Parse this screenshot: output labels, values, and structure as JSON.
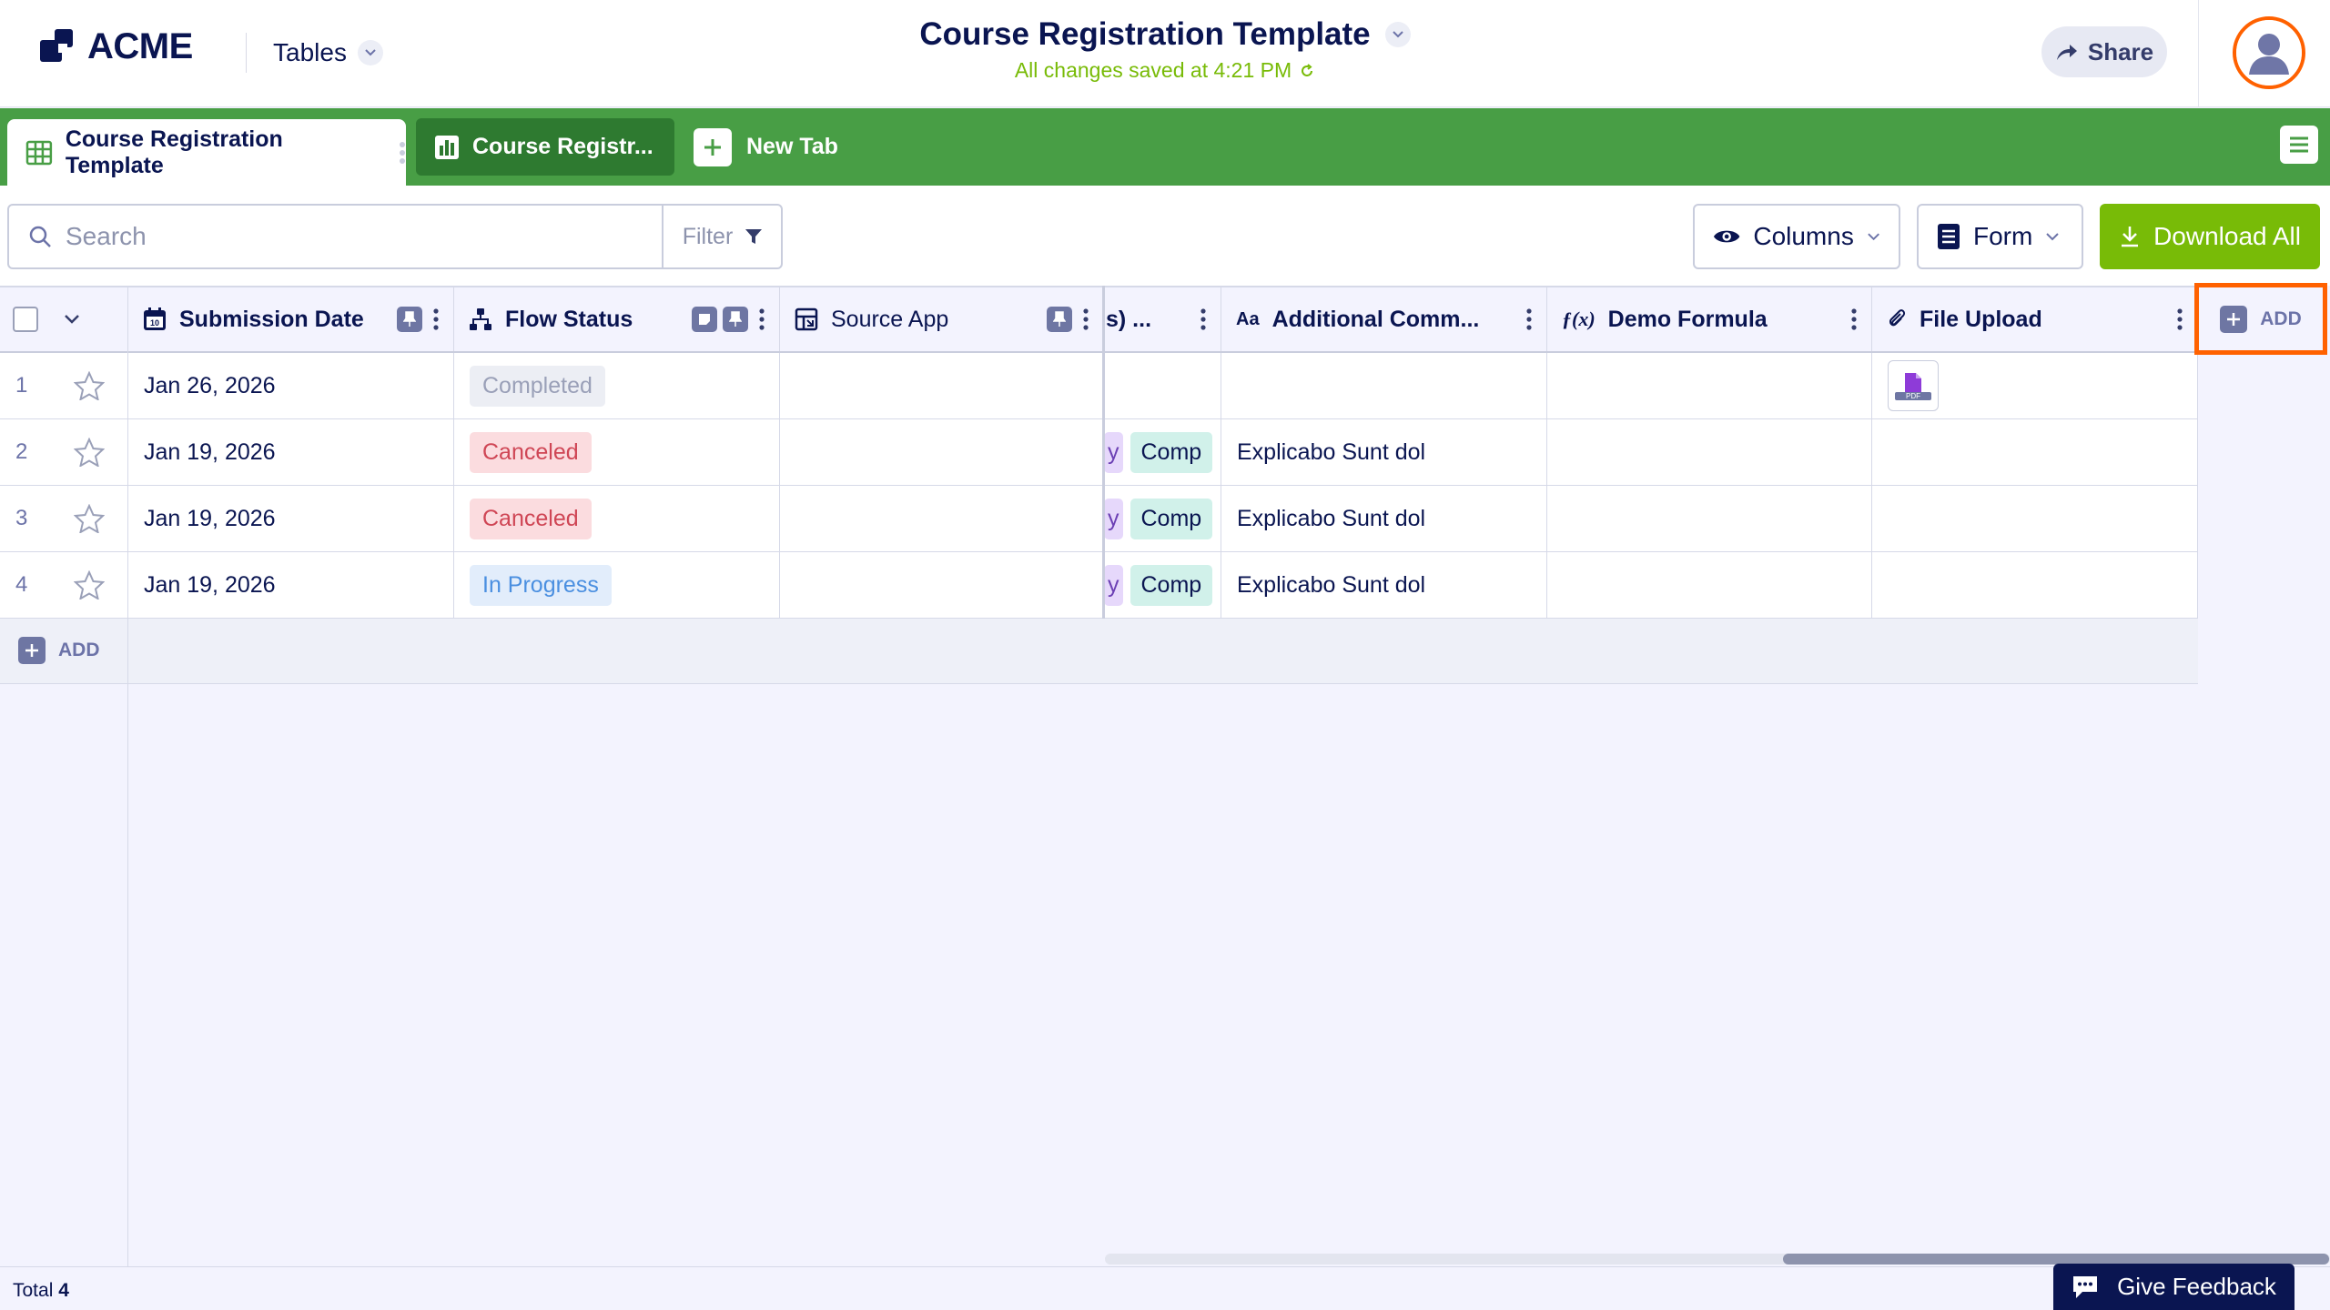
{
  "brand": {
    "name": "ACME",
    "accent": "#ff6100",
    "primary_green": "#489e45",
    "download_green": "#78bb07"
  },
  "header": {
    "tables_label": "Tables",
    "title": "Course Registration Template",
    "saved_status": "All changes saved at 4:21 PM",
    "share_label": "Share"
  },
  "tabs": {
    "items": [
      {
        "label": "Course Registration Template",
        "icon": "table-grid-icon",
        "active": true
      },
      {
        "label": "Course Registr...",
        "icon": "report-chart-icon",
        "active": false
      }
    ],
    "new_tab_label": "New Tab"
  },
  "toolbar": {
    "search_placeholder": "Search",
    "filter_label": "Filter",
    "columns_label": "Columns",
    "form_label": "Form",
    "download_label": "Download All"
  },
  "grid": {
    "columns": [
      {
        "label": "Submission Date",
        "icon": "calendar-icon"
      },
      {
        "label": "Flow Status",
        "icon": "flow-icon"
      },
      {
        "label": "Source App",
        "icon": "source-app-icon"
      },
      {
        "label": "s) ...",
        "icon": ""
      },
      {
        "label": "Additional Comm...",
        "icon": "text-aa-icon"
      },
      {
        "label": "Demo Formula",
        "icon": "formula-icon"
      },
      {
        "label": "File Upload",
        "icon": "paperclip-icon"
      }
    ],
    "rows": [
      {
        "num": "1",
        "date": "Jan 26, 2026",
        "status": "Completed",
        "status_type": "completed",
        "partial_a": "",
        "partial_b": "",
        "comment": "",
        "has_file": true
      },
      {
        "num": "2",
        "date": "Jan 19, 2026",
        "status": "Canceled",
        "status_type": "canceled",
        "partial_a": "y",
        "partial_b": "Comp",
        "comment": "Explicabo Sunt dol",
        "has_file": false
      },
      {
        "num": "3",
        "date": "Jan 19, 2026",
        "status": "Canceled",
        "status_type": "canceled",
        "partial_a": "y",
        "partial_b": "Comp",
        "comment": "Explicabo Sunt dol",
        "has_file": false
      },
      {
        "num": "4",
        "date": "Jan 19, 2026",
        "status": "In Progress",
        "status_type": "progress",
        "partial_a": "y",
        "partial_b": "Comp",
        "comment": "Explicabo Sunt dol",
        "has_file": false
      }
    ],
    "add_row_label": "ADD",
    "add_column_label": "ADD",
    "file_badge": "PDF"
  },
  "footer": {
    "total_label": "Total",
    "total_count": "4",
    "feedback_label": "Give Feedback"
  }
}
